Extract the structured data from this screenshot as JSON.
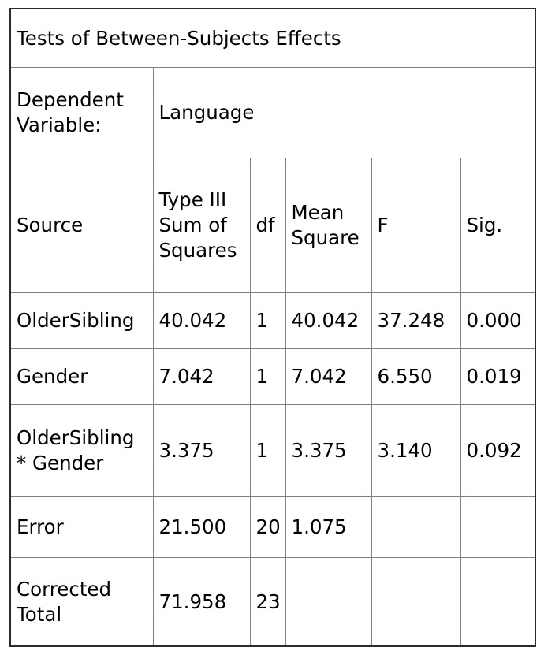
{
  "table": {
    "title": "Tests of Between-Subjects Effects",
    "dependent_variable_label": "Dependent Variable:",
    "dependent_variable_value": "Language",
    "columns": [
      "Source",
      "Type III Sum of Squares",
      "df",
      "Mean Square",
      "F",
      "Sig."
    ],
    "rows": [
      {
        "source": "OlderSibling",
        "sum_of_squares": "40.042",
        "df": "1",
        "mean_square": "40.042",
        "f": "37.248",
        "sig": "0.000"
      },
      {
        "source": "Gender",
        "sum_of_squares": "7.042",
        "df": "1",
        "mean_square": "7.042",
        "f": "6.550",
        "sig": "0.019"
      },
      {
        "source": "OlderSibling * Gender",
        "sum_of_squares": "3.375",
        "df": "1",
        "mean_square": "3.375",
        "f": "3.140",
        "sig": "0.092"
      },
      {
        "source": "Error",
        "sum_of_squares": "21.500",
        "df": "20",
        "mean_square": "1.075",
        "f": "",
        "sig": ""
      },
      {
        "source": "Corrected Total",
        "sum_of_squares": "71.958",
        "df": "23",
        "mean_square": "",
        "f": "",
        "sig": ""
      }
    ]
  },
  "style": {
    "outer_border_color": "#2b2b2b",
    "inner_border_color": "#808080",
    "text_color": "#000000",
    "background_color": "#ffffff"
  }
}
